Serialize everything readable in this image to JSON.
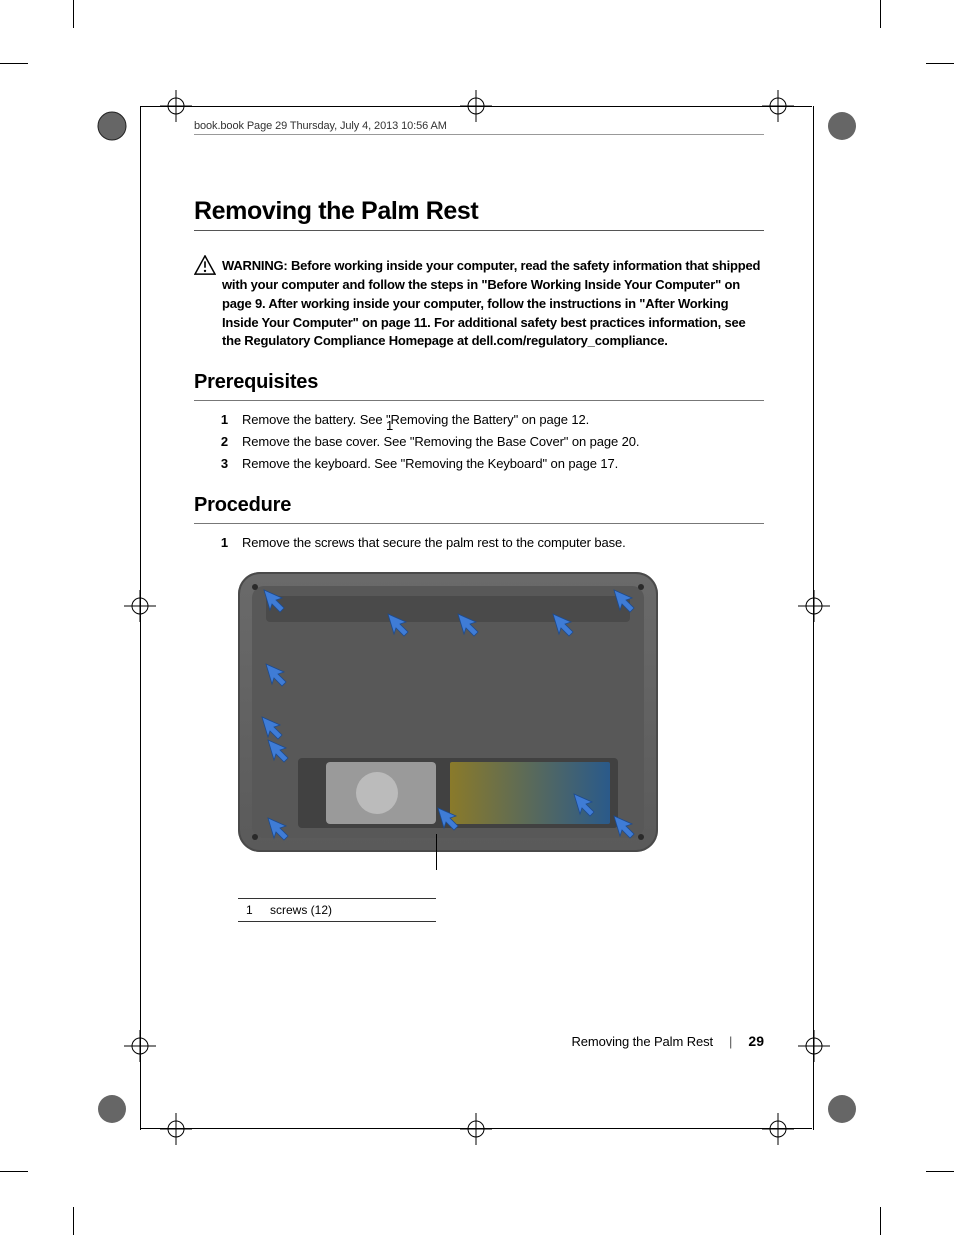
{
  "header": {
    "text": "book.book  Page 29  Thursday, July 4, 2013  10:56 AM"
  },
  "title": "Removing the Palm Rest",
  "warning": {
    "lead": "WARNING:  ",
    "body": "Before working inside your computer, read the safety information that shipped with your computer and follow the steps in \"Before Working Inside Your Computer\" on page 9. After working inside your computer, follow the instructions in \"After Working Inside Your Computer\" on page 11. For additional safety best practices information, see the Regulatory Compliance Homepage at dell.com/regulatory_compliance."
  },
  "sections": {
    "prerequisites": {
      "heading": "Prerequisites",
      "steps": [
        "Remove the battery. See \"Removing the Battery\" on page 12.",
        "Remove the base cover. See \"Removing the Base Cover\" on page 20.",
        "Remove the keyboard. See \"Removing the Keyboard\" on page 17."
      ]
    },
    "procedure": {
      "heading": "Procedure",
      "steps": [
        "Remove the screws that secure the palm rest to the computer base."
      ]
    }
  },
  "figure": {
    "callout_number": "1",
    "callout_table": {
      "num": "1",
      "label": "screws (12)"
    }
  },
  "footer": {
    "title": "Removing the Palm Rest",
    "separator": "|",
    "page_number": "29"
  }
}
